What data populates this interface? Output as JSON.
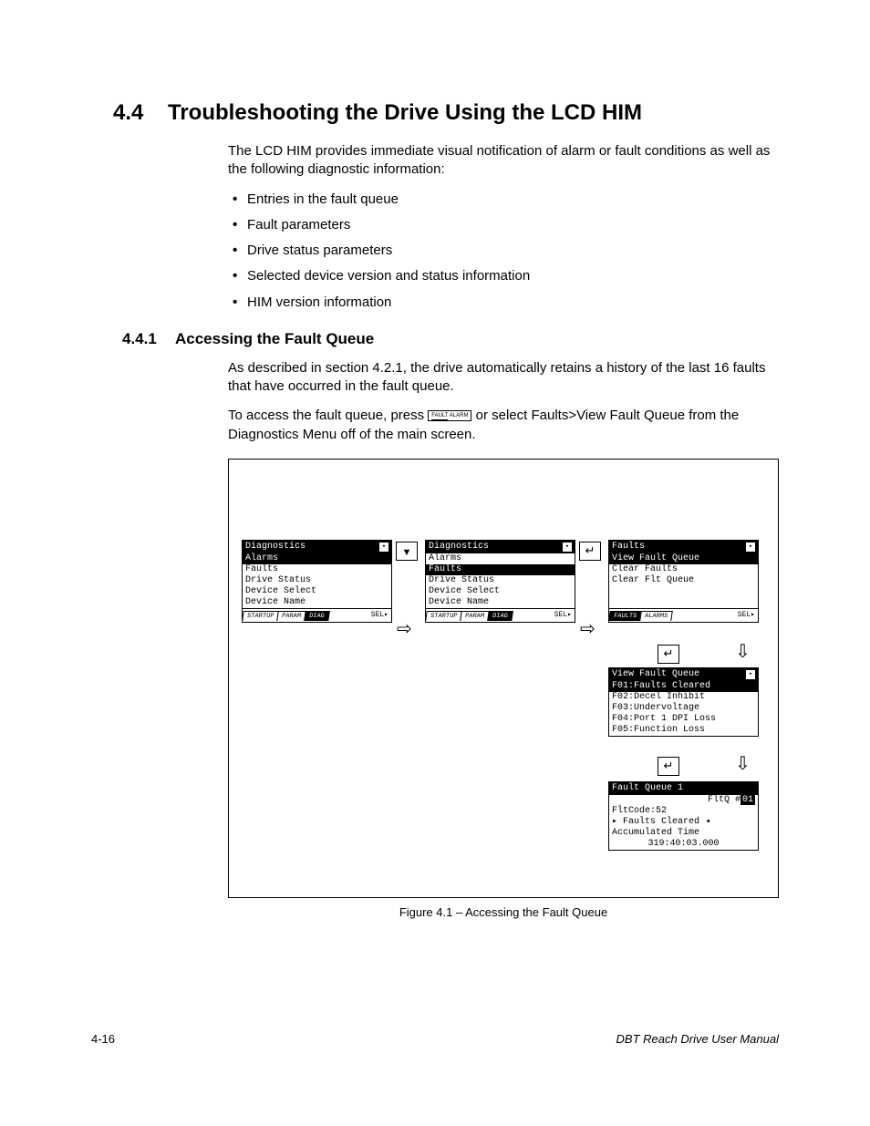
{
  "section": {
    "number": "4.4",
    "title": "Troubleshooting the Drive Using the LCD HIM",
    "intro": "The LCD HIM provides immediate visual notification of alarm or fault conditions as well as the following diagnostic information:",
    "bullets": [
      "Entries in the fault queue",
      "Fault parameters",
      "Drive status parameters",
      "Selected device version and status information",
      "HIM version information"
    ]
  },
  "subsection": {
    "number": "4.4.1",
    "title": "Accessing the Fault Queue",
    "para1": "As described in section 4.2.1, the drive automatically retains a history of the last 16 faults that have occurred in the fault queue.",
    "para2a": "To access the fault queue, press ",
    "para2b": " or select Faults>View Fault Queue from the Diagnostics Menu off of the main screen.",
    "key_top": "FAULT",
    "key_bot": "ALARM"
  },
  "figure": {
    "caption": "Figure 4.1 – Accessing the Fault Queue",
    "screens": {
      "s1": {
        "header": "Diagnostics",
        "items": [
          "Alarms",
          "Faults",
          "Drive Status",
          "Device Select",
          "Device Name"
        ],
        "selected": 0,
        "tabs": [
          "STARTUP",
          "PARAM",
          "DIAG"
        ],
        "tabsel": 2,
        "selLabel": "SEL▸"
      },
      "s2": {
        "header": "Diagnostics",
        "items": [
          "Alarms",
          "Faults",
          "Drive Status",
          "Device Select",
          "Device Name"
        ],
        "selected": 1,
        "tabs": [
          "STARTUP",
          "PARAM",
          "DIAG"
        ],
        "tabsel": 2,
        "selLabel": "SEL▸"
      },
      "s3": {
        "header": "Faults",
        "items": [
          "View Fault Queue",
          "Clear Faults",
          "Clear Flt Queue",
          "",
          ""
        ],
        "selected": 0,
        "tabs": [
          "FAULTS",
          "ALARMS"
        ],
        "tabsel": 0,
        "selLabel": "SEL▸"
      },
      "s4": {
        "header": "View Fault Queue",
        "items": [
          "F01:Faults Cleared",
          "F02:Decel Inhibit",
          "F03:Undervoltage",
          "F04:Port 1 DPI Loss",
          "F05:Function Loss"
        ],
        "selected": 0
      },
      "s5": {
        "header": "Fault Queue 1",
        "fltq_label": "FltQ #",
        "fltq_num": "01",
        "fltcode": "FltCode:52",
        "fault_name": "Faults Cleared",
        "acc_label": "Accumulated Time",
        "acc_time": "319:40:03.000"
      }
    }
  },
  "footer": {
    "page": "4-16",
    "manual": "DBT Reach Drive User Manual"
  }
}
